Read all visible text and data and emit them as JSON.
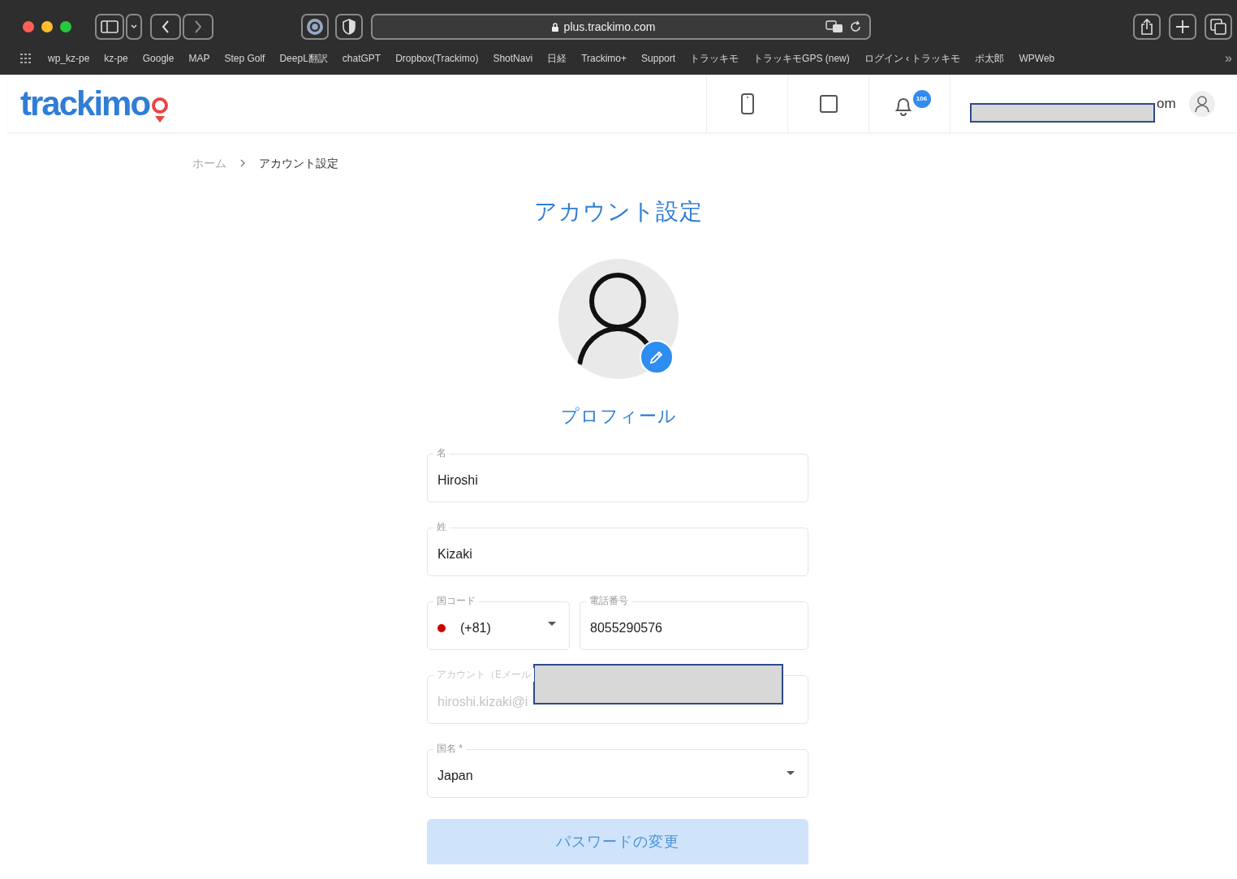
{
  "browser": {
    "url": "plus.trackimo.com",
    "bookmarks": [
      "wp_kz-pe",
      "kz-pe",
      "Google",
      "MAP",
      "Step Golf",
      "DeepL翻訳",
      "chatGPT",
      "Dropbox(Trackimo)",
      "ShotNavi",
      "日経",
      "Trackimo+",
      "Support",
      "トラッキモ",
      "トラッキモGPS (new)",
      "ログイン ‹ トラッキモ",
      "ポ太郎",
      "WPWeb"
    ],
    "overflow": "»"
  },
  "header": {
    "logo": "trackimo",
    "notification_count": "106",
    "user_email_visible": "om"
  },
  "breadcrumb": [
    {
      "label": "ホーム",
      "current": false
    },
    {
      "label": "アカウント設定",
      "current": true
    }
  ],
  "page_title": "アカウント設定",
  "profile_label": "プロフィール",
  "fields": [
    {
      "kind": "text",
      "label": "名",
      "value": "Hiroshi",
      "disabled": false,
      "redacted": false
    },
    {
      "kind": "text",
      "label": "姓",
      "value": "Kizaki",
      "disabled": false,
      "redacted": false
    },
    {
      "kind": "phone",
      "code_label": "国コード",
      "code_value": "(+81)",
      "color": "#cc0000",
      "label": "電話番号",
      "value": "8055290576"
    },
    {
      "kind": "text",
      "label": "アカウント（Eメール",
      "value": "hiroshi.kizaki@i",
      "disabled": true,
      "redacted": true
    },
    {
      "kind": "select",
      "label": "国名 *",
      "value": "Japan"
    }
  ],
  "password_button": "パスワードの変更"
}
